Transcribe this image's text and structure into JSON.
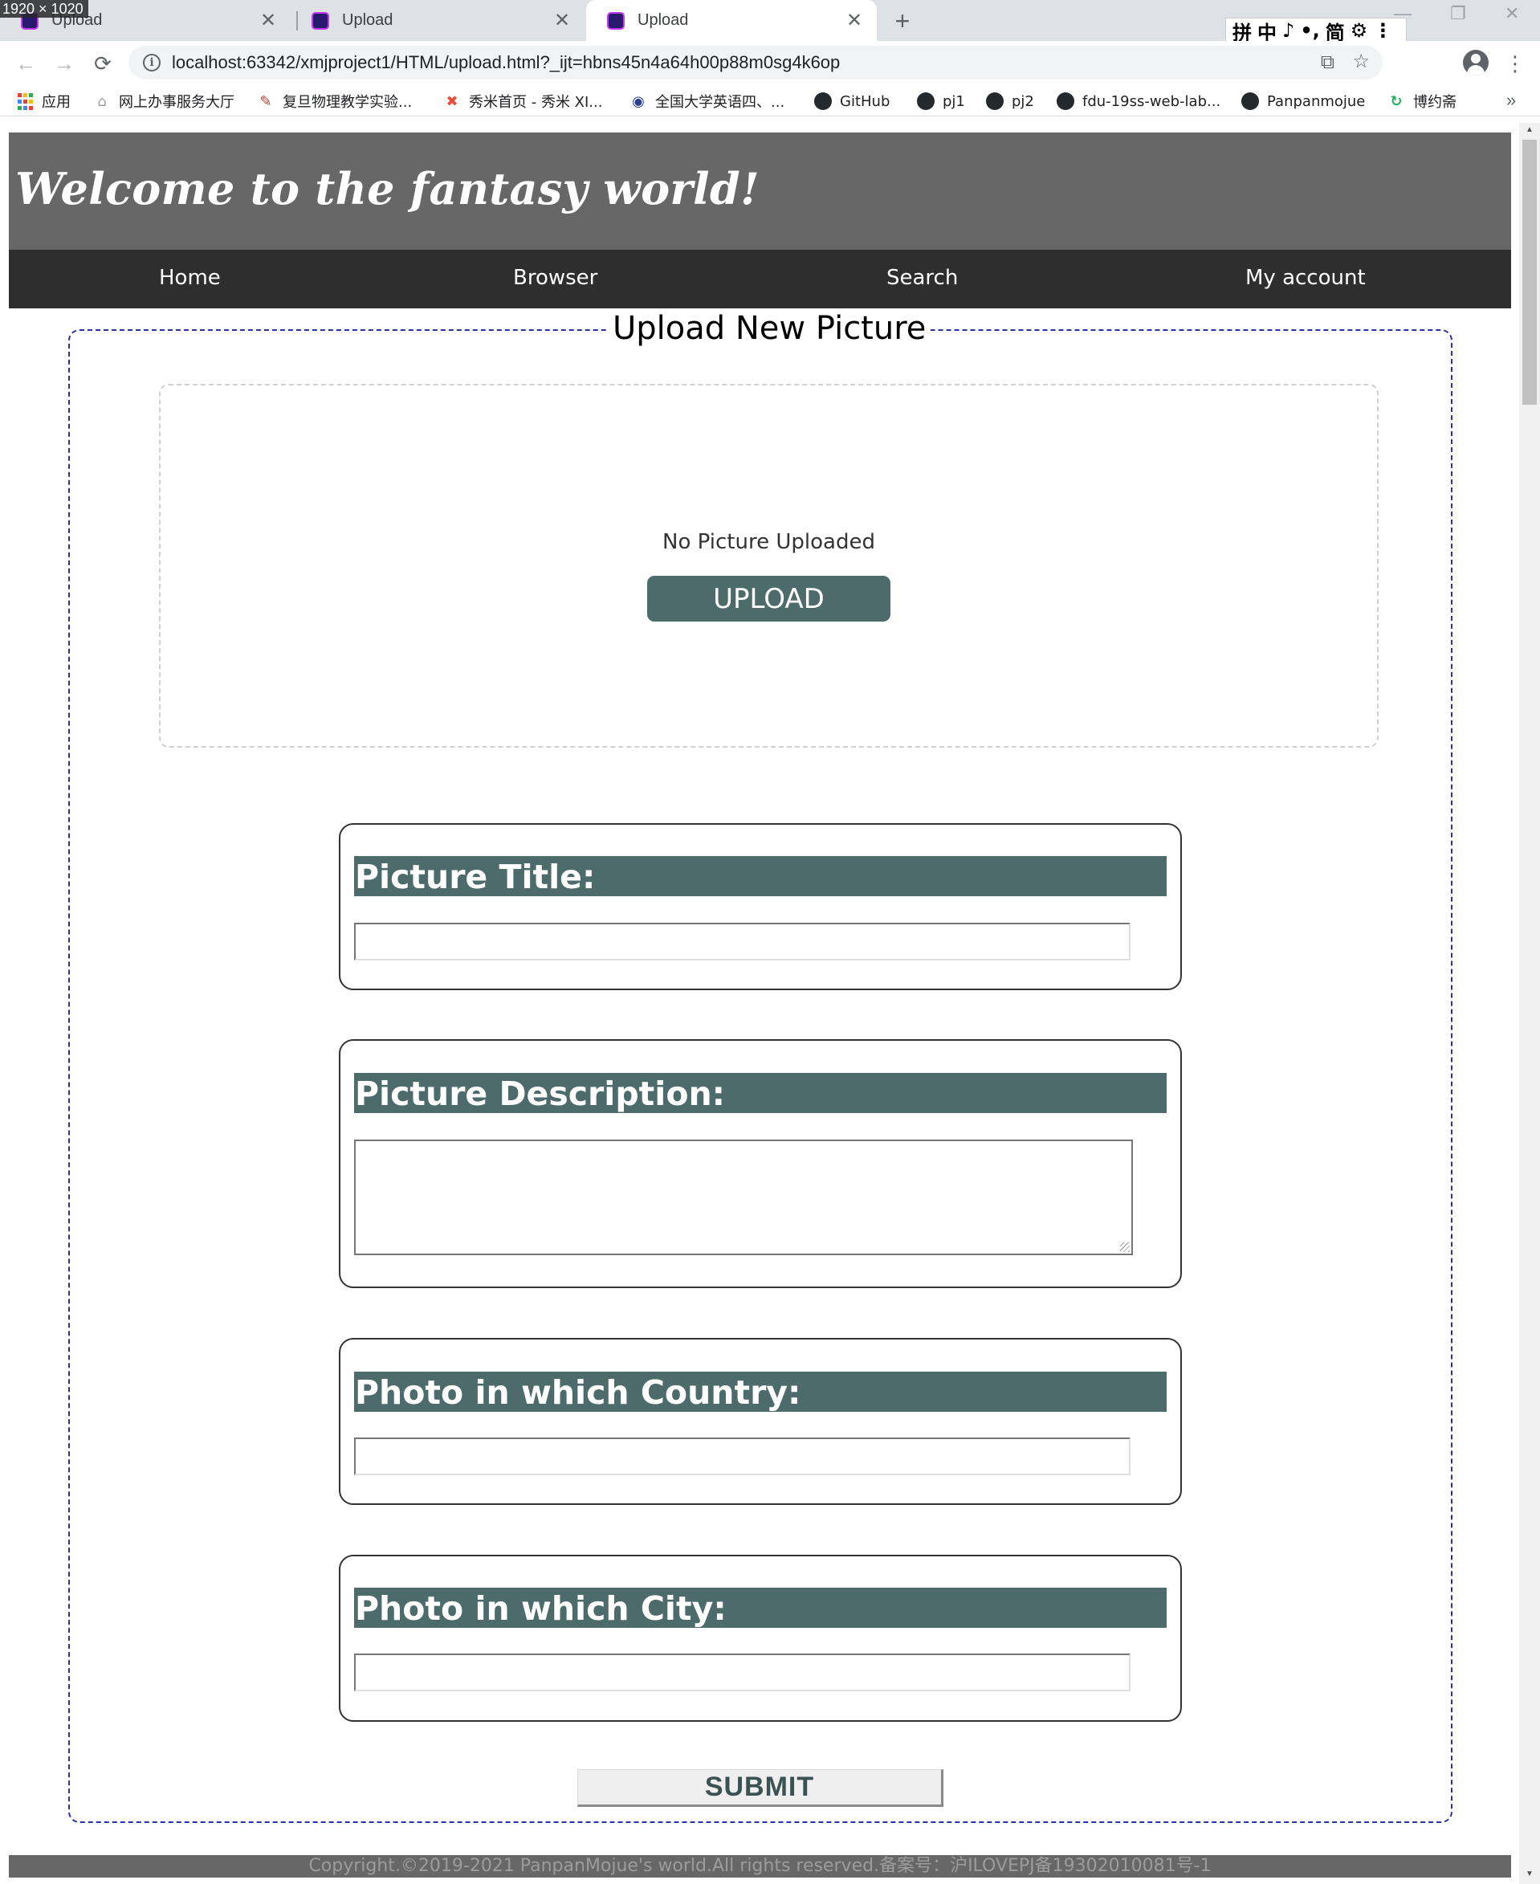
{
  "screen_size_label": "1920 × 1020",
  "tabs": [
    {
      "title": "Upload",
      "close": "✕"
    },
    {
      "title": "Upload",
      "close": "✕"
    },
    {
      "title": "Upload",
      "close": "✕"
    }
  ],
  "new_tab_glyph": "+",
  "ime_bar": [
    "拼",
    "中",
    "♪",
    "•,",
    "简",
    "⚙",
    "⋮"
  ],
  "window_controls": [
    "—",
    "❐",
    "✕"
  ],
  "toolbar": {
    "back": "←",
    "forward": "→",
    "reload": "⟳",
    "info": "i",
    "url": "localhost:63342/xmjproject1/HTML/upload.html?_ijt=hbns45n4a64h00p88m0sg4k6op",
    "translate": "⧉",
    "star": "☆",
    "menu": "⋮"
  },
  "bookmarks": [
    {
      "label": "应用",
      "icon": "apps-icon"
    },
    {
      "label": "网上办事服务大厅",
      "icon": "home-icon"
    },
    {
      "label": "复旦物理教学实验...",
      "icon": "book-icon"
    },
    {
      "label": "秀米首页 - 秀米 XI...",
      "icon": "xiumi-icon"
    },
    {
      "label": "全国大学英语四、...",
      "icon": "globe-icon"
    },
    {
      "label": "GitHub",
      "icon": "github-icon"
    },
    {
      "label": "pj1",
      "icon": "github-icon"
    },
    {
      "label": "pj2",
      "icon": "github-icon"
    },
    {
      "label": "fdu-19ss-web-lab...",
      "icon": "github-icon"
    },
    {
      "label": "Panpanmojue",
      "icon": "github-icon"
    },
    {
      "label": "博约斋",
      "icon": "refresh-circle-icon"
    }
  ],
  "bookmarks_more": "»",
  "page": {
    "header_title": "Welcome to the fantasy world!",
    "nav": [
      "Home",
      "Browser",
      "Search",
      "My account"
    ],
    "legend": "Upload New Picture",
    "no_picture": "No Picture Uploaded",
    "upload_button": "UPLOAD",
    "fields": [
      {
        "label": "Picture Title:",
        "value": ""
      },
      {
        "label": "Picture Description:",
        "value": ""
      },
      {
        "label": "Photo in which Country:",
        "value": ""
      },
      {
        "label": "Photo in which City:",
        "value": ""
      }
    ],
    "submit": "SUBMIT",
    "footer": "Copyright.©2019-2021 PanpanMojue's world.All rights reserved.备案号：沪ILOVEPJ备19302010081号-1"
  },
  "colors": {
    "header_bg": "#676767",
    "nav_bg": "#2e2e2e",
    "accent_teal": "#4e6b6b",
    "fieldset_border": "#2b2fa8"
  }
}
